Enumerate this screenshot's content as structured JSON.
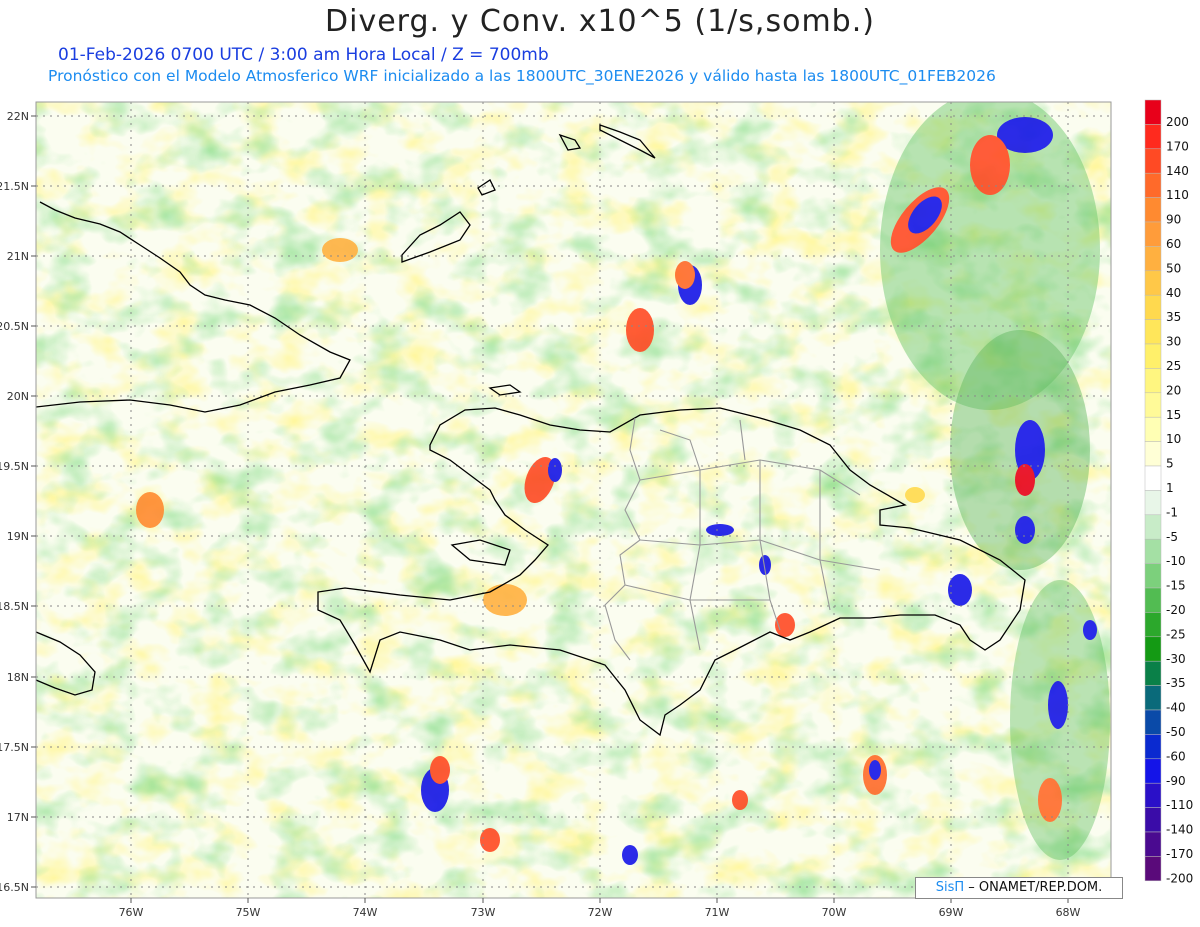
{
  "header": {
    "title": "Diverg. y Conv. x10^5 (1/s,somb.)",
    "subtitle_date": "01-Feb-2026  0700 UTC / 3:00 am Hora Local / Z = 700mb",
    "subtitle_model": "Pronóstico con el Modelo Atmosferico WRF inicializado a las 1800UTC_30ENE2026 y válido hasta las  1800UTC_01FEB2026"
  },
  "axes": {
    "lat_labels": [
      "22N",
      "21.5N",
      "21N",
      "20.5N",
      "20N",
      "19.5N",
      "19N",
      "18.5N",
      "18N",
      "17.5N",
      "17N",
      "16.5N"
    ],
    "lon_labels": [
      "76W",
      "75W",
      "74W",
      "73W",
      "72W",
      "71W",
      "70W",
      "69W",
      "68W"
    ]
  },
  "colorbar": {
    "labels": [
      "200",
      "170",
      "140",
      "110",
      "90",
      "60",
      "50",
      "40",
      "35",
      "30",
      "25",
      "20",
      "15",
      "10",
      "5",
      "1",
      "-1",
      "-5",
      "-10",
      "-15",
      "-20",
      "-25",
      "-30",
      "-35",
      "-40",
      "-50",
      "-60",
      "-90",
      "-110",
      "-140",
      "-170",
      "-200"
    ],
    "colors": [
      "#e8001a",
      "#ff2a1e",
      "#ff4a24",
      "#ff6a2a",
      "#ff8a30",
      "#ff9c3a",
      "#ffb040",
      "#ffc848",
      "#ffd94e",
      "#ffe65a",
      "#fff06a",
      "#fff680",
      "#fffa98",
      "#ffffb4",
      "#ffffd6",
      "#ffffff",
      "#e8f6e8",
      "#c8ecc8",
      "#a4e0a4",
      "#7cd07c",
      "#52bc52",
      "#2ca82c",
      "#149a14",
      "#0a8048",
      "#0a6a7a",
      "#0a4aa8",
      "#0a2ad0",
      "#1414e8",
      "#2a10c8",
      "#3a0ca8",
      "#4a0a90",
      "#5a0a7a"
    ]
  },
  "credit": {
    "brand": "SisΠ",
    "text": "– ONAMET/REP.DOM."
  }
}
